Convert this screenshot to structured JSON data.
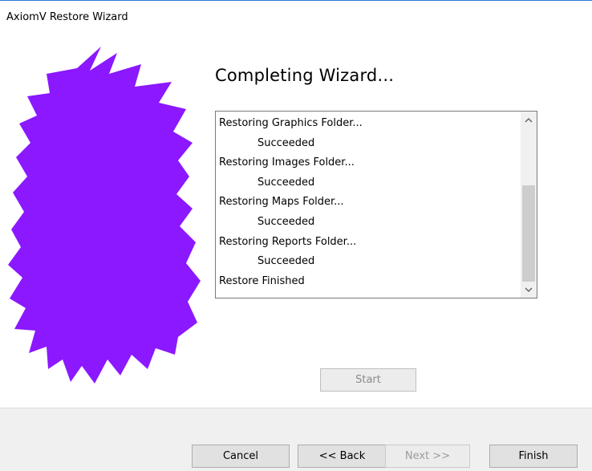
{
  "window": {
    "title": "AxiomV Restore Wizard"
  },
  "heading": "Completing Wizard...",
  "log": {
    "lines": [
      {
        "text": "Restoring Graphics Folder...",
        "indent": false
      },
      {
        "text": "Succeeded",
        "indent": true
      },
      {
        "text": "Restoring Images Folder...",
        "indent": false
      },
      {
        "text": "Succeeded",
        "indent": true
      },
      {
        "text": "Restoring Maps Folder...",
        "indent": false
      },
      {
        "text": "Succeeded",
        "indent": true
      },
      {
        "text": "Restoring Reports Folder...",
        "indent": false
      },
      {
        "text": "Succeeded",
        "indent": true
      },
      {
        "text": "Restore Finished",
        "indent": false
      }
    ],
    "scroll_up_icon": "chevron-up-icon",
    "scroll_down_icon": "chevron-down-icon"
  },
  "buttons": {
    "start": "Start",
    "cancel": "Cancel",
    "back": "<< Back",
    "next": "Next >>",
    "finish": "Finish"
  },
  "colors": {
    "logo": "#8b18ff",
    "title_border": "#2b79d8"
  }
}
